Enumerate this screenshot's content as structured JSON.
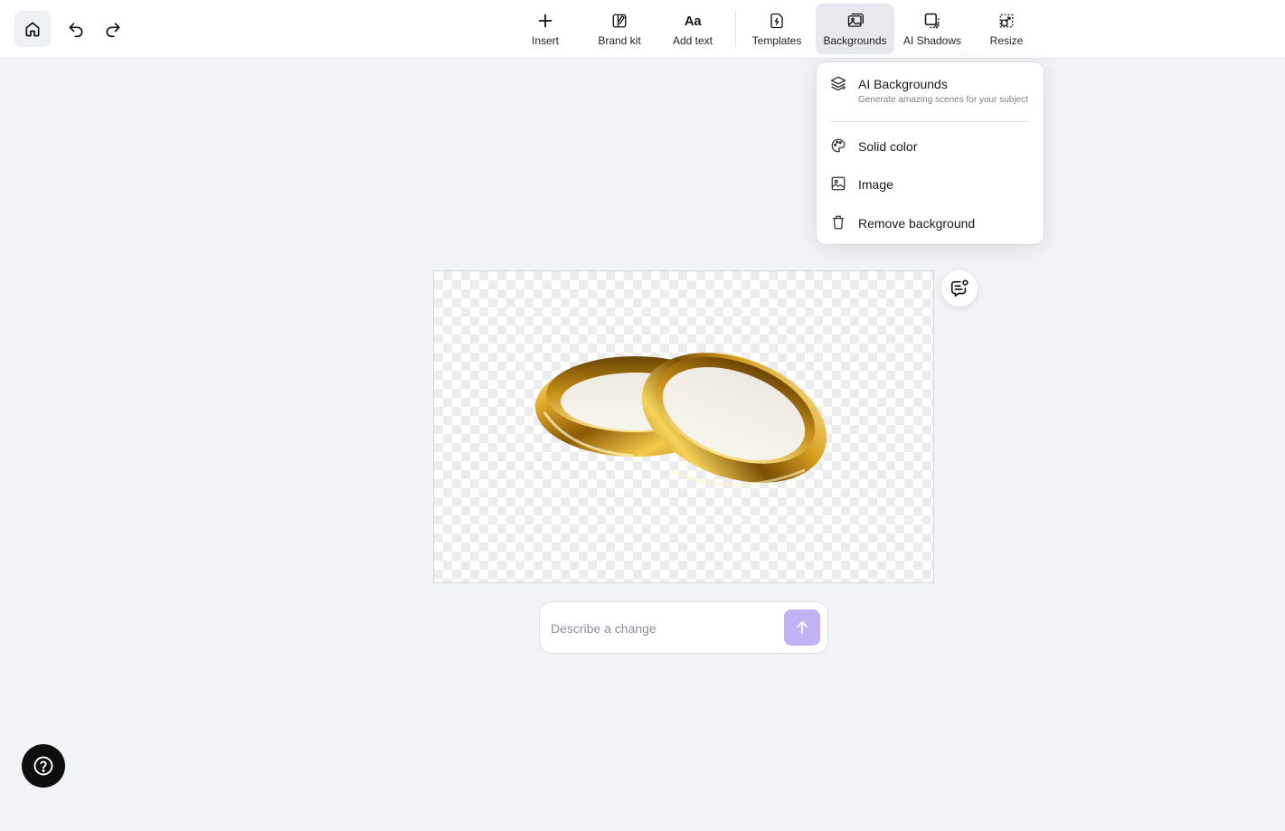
{
  "toolbar": {
    "tools": [
      {
        "id": "insert",
        "label": "Insert",
        "icon": "plus-icon"
      },
      {
        "id": "brand-kit",
        "label": "Brand kit",
        "icon": "brand-kit-icon"
      },
      {
        "id": "add-text",
        "label": "Add text",
        "icon": "text-icon",
        "glyph": "Aa"
      },
      {
        "id": "templates",
        "label": "Templates",
        "icon": "templates-icon"
      },
      {
        "id": "backgrounds",
        "label": "Backgrounds",
        "icon": "backgrounds-icon",
        "active": true
      },
      {
        "id": "ai-shadows",
        "label": "AI Shadows",
        "icon": "shadow-icon"
      },
      {
        "id": "resize",
        "label": "Resize",
        "icon": "resize-icon"
      }
    ]
  },
  "backgrounds_menu": {
    "items": [
      {
        "title": "AI Backgrounds",
        "subtitle": "Generate amazing scenes for your subject",
        "icon": "layers-sparkle-icon"
      },
      {
        "title": "Solid color",
        "icon": "palette-icon"
      },
      {
        "title": "Image",
        "icon": "image-icon"
      },
      {
        "title": "Remove background",
        "icon": "trash-icon"
      }
    ]
  },
  "prompt": {
    "placeholder": "Describe a change",
    "value": ""
  },
  "colors": {
    "accent": "#c3b2f7",
    "background": "#f2f3f7",
    "help_button": "#0e0e0e",
    "active_tool": "#e8e9ee"
  }
}
